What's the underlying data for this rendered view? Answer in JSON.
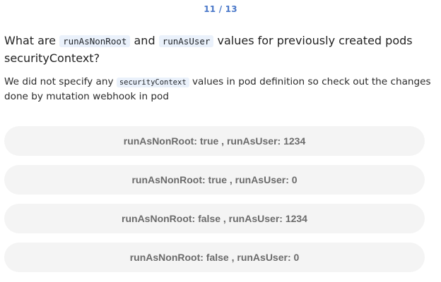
{
  "progress": {
    "counter": "11 / 13"
  },
  "question": {
    "prefix": "What are ",
    "code1": "runAsNonRoot",
    "middle": " and ",
    "code2": "runAsUser",
    "suffix": " values for previously created pods securityContext?"
  },
  "hint": {
    "prefix": "We did not specify any ",
    "code": "securityContext",
    "suffix": " values in pod definition so check out the changes done by mutation webhook in pod"
  },
  "options": [
    {
      "label": "runAsNonRoot: true , runAsUser: 1234"
    },
    {
      "label": "runAsNonRoot: true , runAsUser: 0"
    },
    {
      "label": "runAsNonRoot: false , runAsUser: 1234"
    },
    {
      "label": "runAsNonRoot: false , runAsUser: 0"
    }
  ]
}
